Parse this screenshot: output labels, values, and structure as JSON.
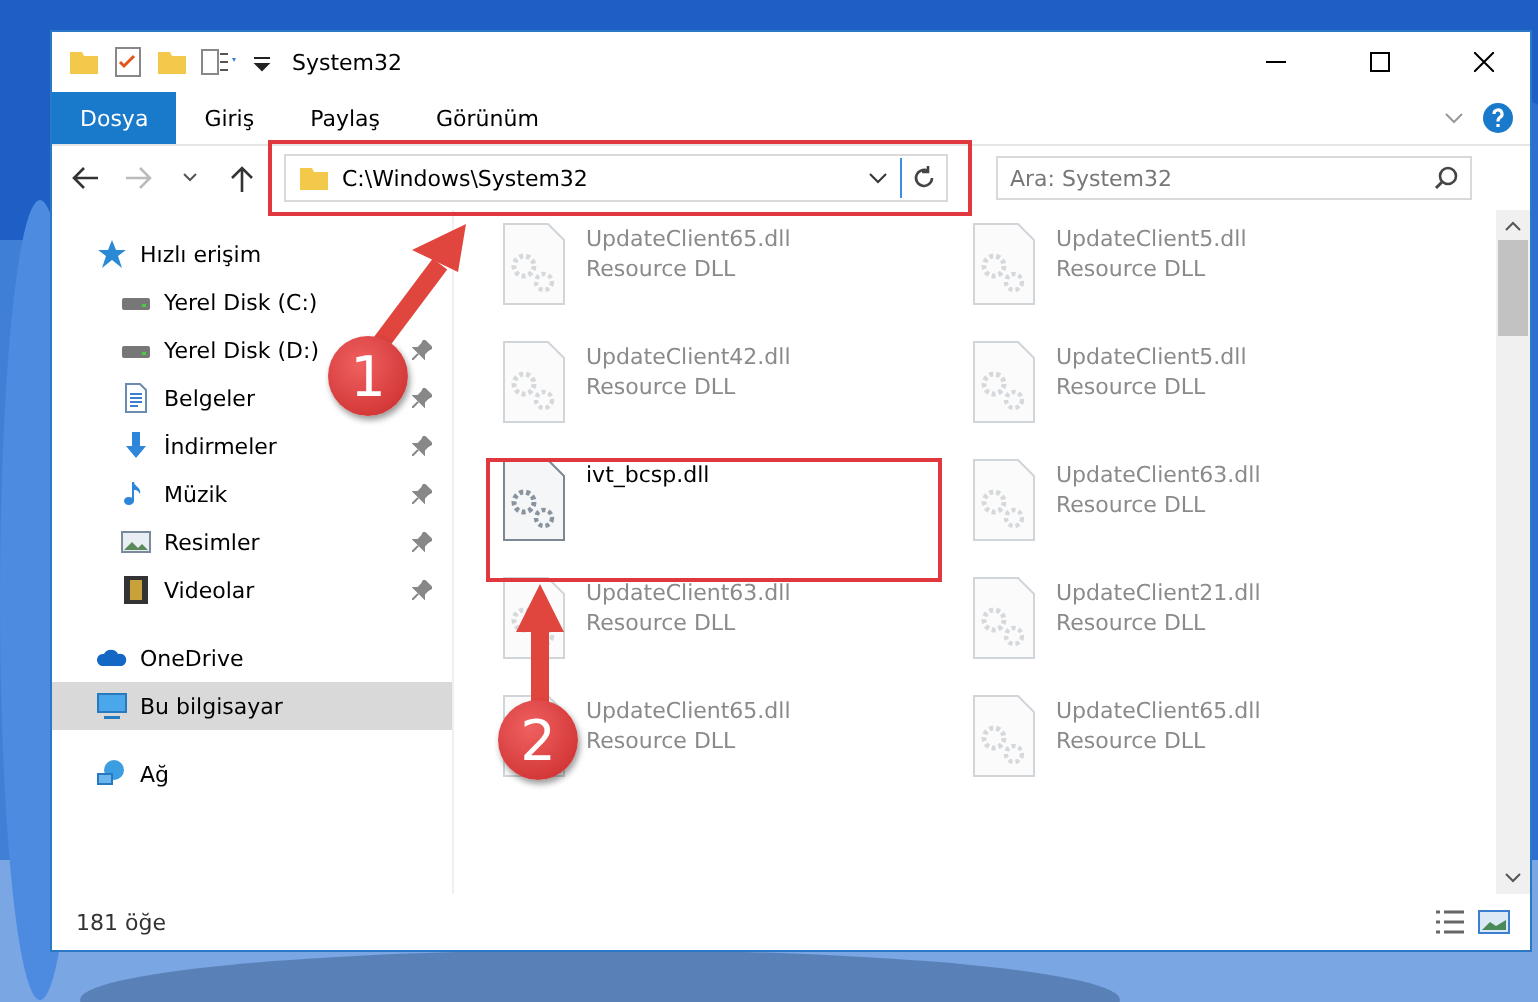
{
  "window": {
    "title": "System32"
  },
  "ribbon_tabs": [
    {
      "label": "Dosya",
      "kind": "file"
    },
    {
      "label": "Giriş",
      "kind": "tab"
    },
    {
      "label": "Paylaş",
      "kind": "tab"
    },
    {
      "label": "Görünüm",
      "kind": "tab"
    }
  ],
  "address_bar": {
    "path": "C:\\Windows\\System32"
  },
  "search": {
    "placeholder": "Ara: System32"
  },
  "sidebar": {
    "items": [
      {
        "label": "Hızlı erişim",
        "kind": "star",
        "selected": false,
        "children": [
          {
            "label": "Yerel Disk (C:)",
            "kind": "drive",
            "pinned": false
          },
          {
            "label": "Yerel Disk (D:)",
            "kind": "drive",
            "pinned": true
          },
          {
            "label": "Belgeler",
            "kind": "document",
            "pinned": true
          },
          {
            "label": "İndirmeler",
            "kind": "download",
            "pinned": true
          },
          {
            "label": "Müzik",
            "kind": "music",
            "pinned": true
          },
          {
            "label": "Resimler",
            "kind": "pictures",
            "pinned": true
          },
          {
            "label": "Videolar",
            "kind": "video",
            "pinned": true
          }
        ]
      },
      {
        "label": "OneDrive",
        "kind": "cloud",
        "selected": false
      },
      {
        "label": "Bu bilgisayar",
        "kind": "computer",
        "selected": true
      },
      {
        "label": "Ağ",
        "kind": "network",
        "selected": false
      }
    ]
  },
  "files": [
    {
      "name": "UpdateClient65.dll",
      "type": "Resource DLL",
      "blurred": true
    },
    {
      "name": "UpdateClient5.dll",
      "type": "Resource DLL",
      "blurred": true
    },
    {
      "name": "UpdateClient42.dll",
      "type": "Resource DLL",
      "blurred": true
    },
    {
      "name": "UpdateClient5.dll",
      "type": "Resource DLL",
      "blurred": true
    },
    {
      "name": "ivt_bcsp.dll",
      "blurred": false
    },
    {
      "name": "UpdateClient63.dll",
      "type": "Resource DLL",
      "blurred": true
    },
    {
      "name": "UpdateClient63.dll",
      "type": "Resource DLL",
      "blurred": true
    },
    {
      "name": "UpdateClient21.dll",
      "type": "Resource DLL",
      "blurred": true
    },
    {
      "name": "UpdateClient65.dll",
      "type": "Resource DLL",
      "blurred": true
    },
    {
      "name": "UpdateClient65.dll",
      "type": "Resource DLL",
      "blurred": true
    }
  ],
  "status_bar": {
    "count": "181 öğe"
  },
  "annotations": [
    {
      "number": "1"
    },
    {
      "number": "2"
    }
  ]
}
